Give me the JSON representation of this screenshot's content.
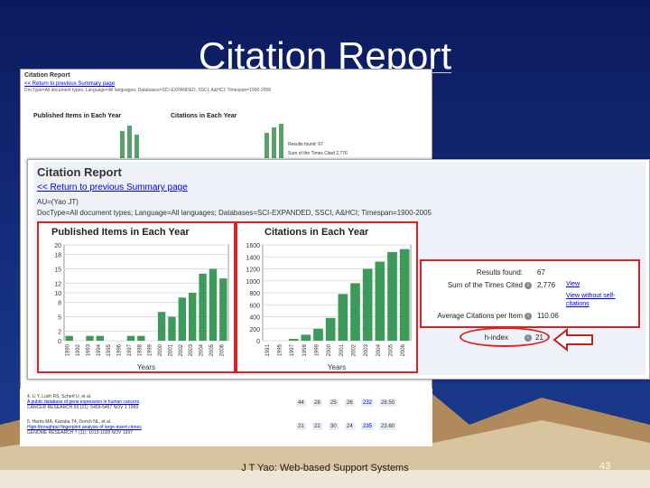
{
  "slide": {
    "title": "Citation Report",
    "footer": "J T Yao: Web-based Support Systems",
    "page": "43"
  },
  "report": {
    "heading": "Citation Report",
    "back_link": "<< Return to previous Summary page",
    "name_line": "AU=(Yao JT)",
    "query": "DocType=All document types; Language=All languages; Databases=SCI-EXPANDED, SSCI, A&HCI; Timespan=1900-2005",
    "bg_heading": "Citation Report",
    "bg_back_link": "<< Return to previous Summary page",
    "bg_query": "DocType=All document types; Language=All languages; Databases=SCI-EXPANDED, SSCI, A&HCI; Timespan=1900-2006",
    "bg_published_title": "Published Items in Each Year",
    "bg_citations_title": "Citations in Each Year"
  },
  "stats": {
    "results_found_label": "Results found:",
    "results_found": "67",
    "sum_times_cited_label": "Sum of the Times Cited",
    "sum_times_cited": "2,776",
    "view_link": "View",
    "view_without_self": "View without self-citations",
    "avg_label": "Average Citations per Item",
    "avg_value": "110.06",
    "h_index_label": "h-index",
    "h_index": "21"
  },
  "chart_data": [
    {
      "type": "bar",
      "title": "Published Items in Each Year",
      "xlabel": "Years",
      "ylabel": "",
      "ylim": [
        0,
        20
      ],
      "yticks": [
        0,
        2,
        5,
        8,
        10,
        12,
        15,
        18,
        20
      ],
      "categories": [
        "1990",
        "1992",
        "1993",
        "1994",
        "1995",
        "1996",
        "1997",
        "1998",
        "1999",
        "2000",
        "2001",
        "2002",
        "2003",
        "2004",
        "2005",
        "2006"
      ],
      "values": [
        1,
        0,
        1,
        1,
        0,
        0,
        1,
        1,
        0,
        6,
        5,
        9,
        10,
        14,
        15,
        13
      ]
    },
    {
      "type": "bar",
      "title": "Citations in Each Year",
      "xlabel": "Years",
      "ylabel": "",
      "ylim": [
        0,
        1600
      ],
      "yticks": [
        0,
        200,
        400,
        600,
        800,
        1000,
        1200,
        1400,
        1600
      ],
      "categories": [
        "1991",
        "1995",
        "1997",
        "1998",
        "1999",
        "2000",
        "2001",
        "2002",
        "2003",
        "2004",
        "2005",
        "2006"
      ],
      "values": [
        0,
        0,
        30,
        100,
        200,
        380,
        780,
        960,
        1200,
        1320,
        1480,
        1530
      ]
    }
  ],
  "list": {
    "item4_num": "4.",
    "item4_authors": "Li Y, Lush RS, Scherf U, et al.",
    "item4_title": "A public database of gene expression in human cancers",
    "item4_source": "CANCER RESEARCH 59 (21): 5459-5467 NOV 1 1999",
    "item4_cells": [
      "44",
      "28",
      "25",
      "26",
      "232",
      "28.50"
    ],
    "item5_num": "5.",
    "item5_authors": "Harris MA, Kazaba T4, Dorich NL, et al.",
    "item5_title": "High-throughput fingerprint analysis of large-insert clones",
    "item5_source": "GENOME RESEARCH 7 (11): 1013-1028 NOV 1997",
    "item5_cells": [
      "21",
      "22",
      "30",
      "24",
      "235",
      "23.60"
    ]
  }
}
